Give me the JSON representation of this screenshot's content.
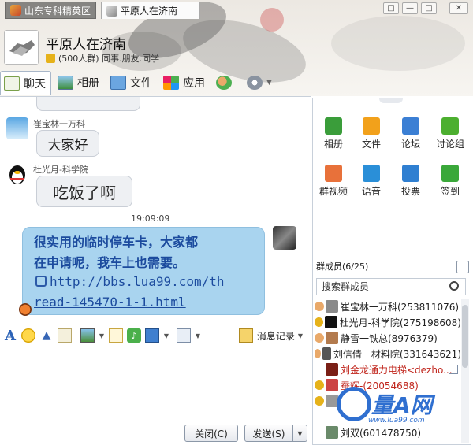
{
  "tabs": [
    {
      "label": "山东专科精英区",
      "active": false
    },
    {
      "label": "平原人在济南",
      "active": true
    }
  ],
  "window_buttons": [
    "□",
    "—",
    "□",
    "✕"
  ],
  "group": {
    "name": "平原人在济南",
    "subtitle": "(500人群) 同事.朋友.同学"
  },
  "toolbar": {
    "chat": "聊天",
    "album": "相册",
    "files": "文件",
    "apps": "应用"
  },
  "messages": [
    {
      "sender": "崔宝林一万科",
      "text": "大家好"
    },
    {
      "sender": "杜光月-科学院",
      "text": "吃饭了啊"
    }
  ],
  "timestamp": "19:09:09",
  "big_message": {
    "line1": "很实用的临时停车卡，大家都",
    "line2": "在申请呢，我车上也需要。",
    "link1": "http://bbs.lua99.com/th",
    "link2": "read-145470-1-1.html"
  },
  "history_label": "消息记录",
  "buttons": {
    "close": "关闭(C)",
    "send": "发送(S)"
  },
  "apps": [
    {
      "label": "相册",
      "color": "#3a9d3a"
    },
    {
      "label": "文件",
      "color": "#f2a11b"
    },
    {
      "label": "论坛",
      "color": "#3b7fd4"
    },
    {
      "label": "讨论组",
      "color": "#4caf2f"
    },
    {
      "label": "群视频",
      "color": "#e8713a"
    },
    {
      "label": "语音",
      "color": "#2a8fd8"
    },
    {
      "label": "投票",
      "color": "#2f7fd1"
    },
    {
      "label": "签到",
      "color": "#3aa83a"
    }
  ],
  "members": {
    "header": "群成员(6/25)",
    "search_placeholder": "搜索群成员",
    "list": [
      {
        "name": "崔宝林一万科(253811076)",
        "color": "#222"
      },
      {
        "name": "杜光月-科学院(275198608)",
        "color": "#222"
      },
      {
        "name": "静雪一铁总(8976379)",
        "color": "#222"
      },
      {
        "name": "刘信倩一材料院(331643621)",
        "color": "#222"
      },
      {
        "name": "刘金龙通力电梯<dezho...",
        "color": "#c0241b"
      },
      {
        "name": "蚕辉-(20054688)",
        "color": "#c0241b"
      },
      {
        "name": "",
        "color": "#222"
      },
      {
        "name": "刘双(601478750)",
        "color": "#222"
      }
    ]
  },
  "watermark": {
    "main": "量A网",
    "url": "www.lua99.com"
  }
}
